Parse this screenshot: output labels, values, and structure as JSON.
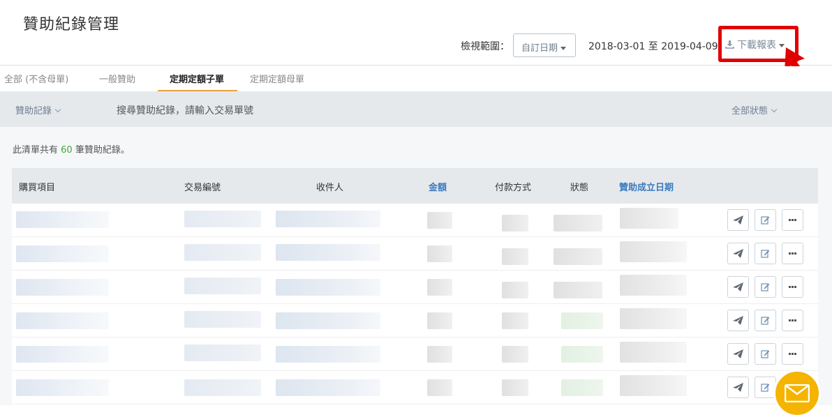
{
  "header": {
    "title": "贊助紀錄管理",
    "range_label": "檢視範圍：",
    "date_select": "自訂日期",
    "date_range": "2018-03-01 至 2019-04-09",
    "download": "下載報表"
  },
  "tabs": [
    {
      "label": "全部 (不含母單)"
    },
    {
      "label": "一般贊助"
    },
    {
      "label": "定期定額子單"
    },
    {
      "label": "定期定額母單"
    }
  ],
  "filter": {
    "type": "贊助記錄",
    "search_placeholder": "搜尋贊助紀錄，請輸入交易單號",
    "status": "全部狀態"
  },
  "summary": {
    "prefix": "此清單共有",
    "count": "60",
    "suffix": "筆贊助紀錄。"
  },
  "table": {
    "columns": [
      "購買項目",
      "交易編號",
      "收件人",
      "金額",
      "付款方式",
      "狀態",
      "贊助成立日期"
    ]
  },
  "colors": {
    "accent": "#e8a23a",
    "link": "#3b7bbf",
    "highlight": "#e00000",
    "fab": "#f4b400"
  }
}
